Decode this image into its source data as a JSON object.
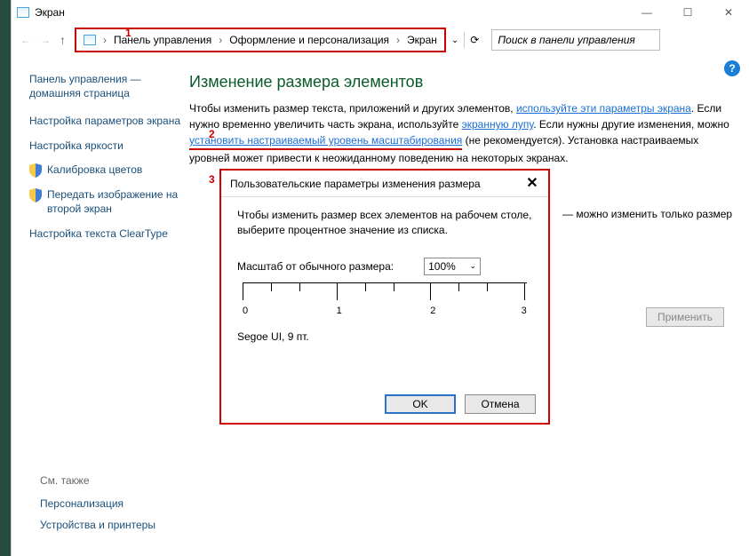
{
  "window": {
    "title": "Экран"
  },
  "breadcrumbs": [
    "Панель управления",
    "Оформление и персонализация",
    "Экран"
  ],
  "search_placeholder": "Поиск в панели управления",
  "annot": {
    "1": "1",
    "2": "2",
    "3": "3"
  },
  "sidebar": {
    "home": "Панель управления — домашняя страница",
    "items": [
      {
        "label": "Настройка параметров экрана"
      },
      {
        "label": "Настройка яркости"
      },
      {
        "label": "Калибровка цветов",
        "shield": true
      },
      {
        "label": "Передать изображение на второй экран",
        "shield": true
      },
      {
        "label": "Настройка текста ClearType"
      }
    ]
  },
  "main": {
    "h1": "Изменение размера элементов",
    "p1a": "Чтобы изменить размер текста, приложений и других элементов, ",
    "p1link": "используйте эти параметры экрана",
    "p1b": ". Если нужно временно увеличить часть экрана, используйте ",
    "p1link2": "экранную лупу",
    "p1c": ". Если нужны другие изменения, можно ",
    "p1link3": "установить настраиваемый уровень масштабирования",
    "p1d": " (не рекомендуется). Установка настраиваемых уровней может привести к неожиданному поведению на некоторых экранах.",
    "right": "можно изменить только размер",
    "apply": "Применить"
  },
  "dialog": {
    "title": "Пользовательские параметры изменения размера",
    "intro": "Чтобы изменить размер всех элементов на рабочем столе, выберите процентное значение из списка.",
    "scale_label": "Масштаб от обычного размера:",
    "scale_value": "100%",
    "ruler": {
      "ticks": [
        "0",
        "1",
        "2",
        "3"
      ]
    },
    "font": "Segoe UI, 9 пт.",
    "ok": "OK",
    "cancel": "Отмена"
  },
  "footer": {
    "hdr": "См. также",
    "links": [
      "Персонализация",
      "Устройства и принтеры"
    ]
  }
}
